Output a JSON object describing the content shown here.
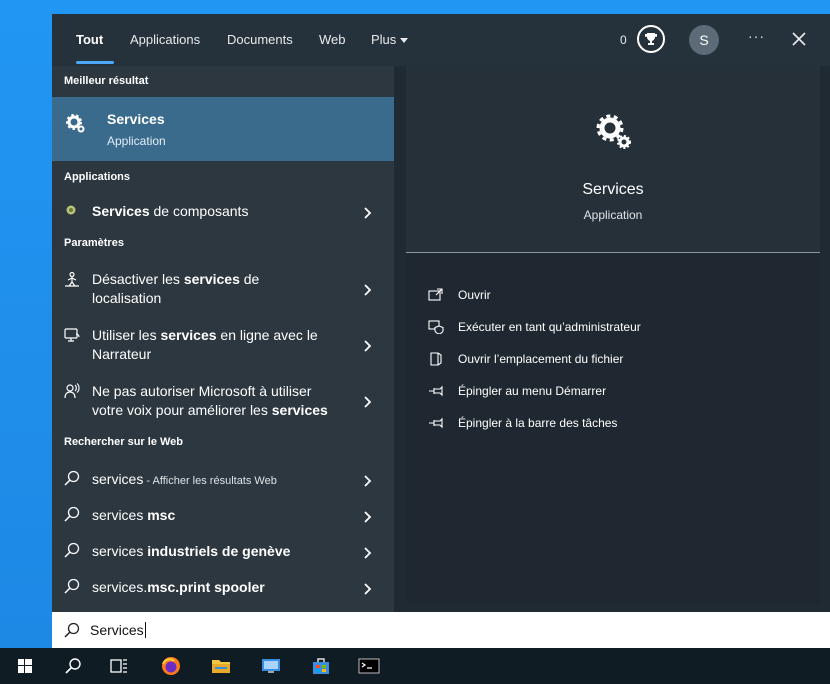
{
  "tabs": {
    "all": "Tout",
    "applications": "Applications",
    "documents": "Documents",
    "web": "Web",
    "more": "Plus"
  },
  "header": {
    "reward_count": "0",
    "avatar_letter": "S",
    "more_label": "···"
  },
  "left": {
    "best_title": "Meilleur résultat",
    "best": {
      "name": "Services",
      "type": "Application"
    },
    "apps_title": "Applications",
    "apps": [
      {
        "bold": "Services",
        "rest": " de composants"
      }
    ],
    "settings_title": "Paramètres",
    "settings": [
      {
        "pre": "Désactiver les ",
        "bold": "services",
        "post": " de",
        "line2": "localisation"
      },
      {
        "pre": "Utiliser les ",
        "bold": "services",
        "post": " en ligne avec le",
        "line2": "Narrateur"
      },
      {
        "pre": "Ne pas autoriser Microsoft à utiliser",
        "line2pre": "votre voix pour améliorer les ",
        "line2bold": "services"
      }
    ],
    "web_title": "Rechercher sur le Web",
    "web": [
      {
        "pre": "services",
        "small": " - Afficher les résultats Web",
        "bold": ""
      },
      {
        "pre": "services ",
        "bold": "msc"
      },
      {
        "pre": "services ",
        "bold": "industriels de genève"
      },
      {
        "pre": "services.",
        "bold": "msc.print spooler"
      }
    ]
  },
  "right": {
    "name": "Services",
    "type": "Application",
    "actions": [
      "Ouvrir",
      "Exécuter en tant qu’administrateur",
      "Ouvrir l’emplacement du fichier",
      "Épingler au menu Démarrer",
      "Épingler à la barre des tâches"
    ]
  },
  "search": {
    "value": "Services"
  },
  "colors": {
    "accent": "#4aa8ff",
    "selected": "#3a6a8c",
    "desktop": "#1e88e5",
    "panel": "#202a33"
  }
}
